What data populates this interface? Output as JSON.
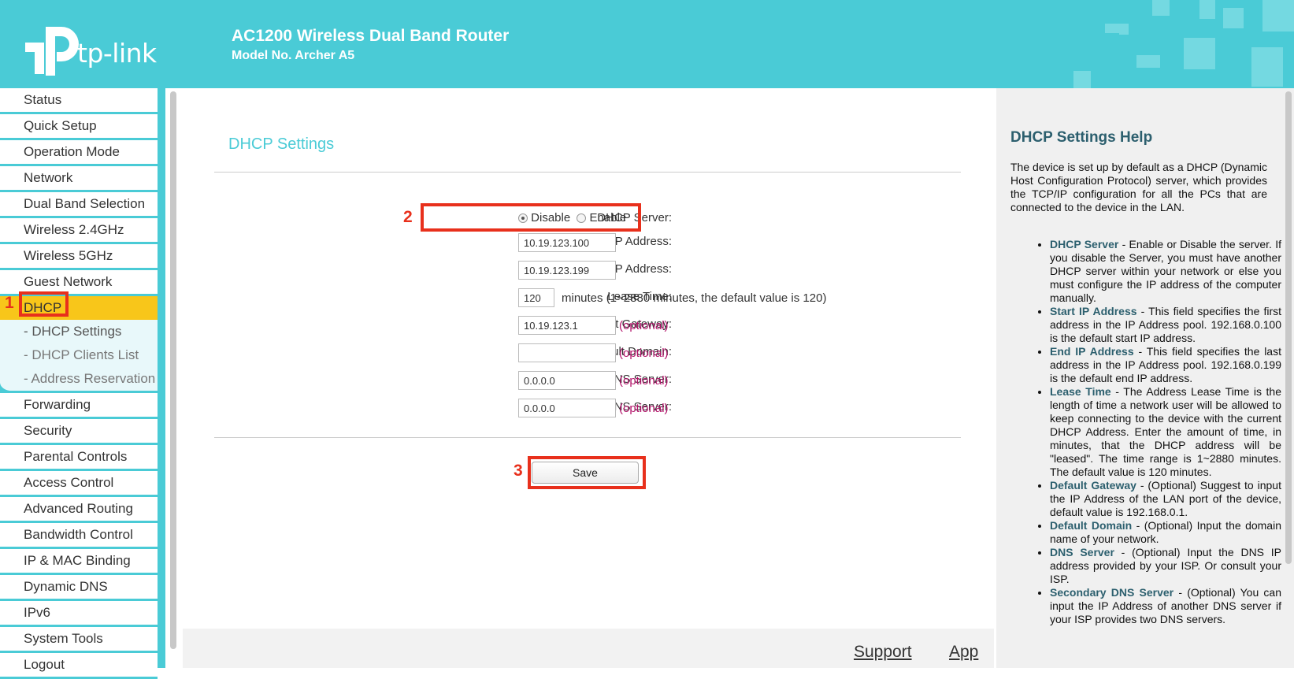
{
  "header": {
    "brand": "tp-link",
    "title": "AC1200 Wireless Dual Band Router",
    "model": "Model No. Archer A5"
  },
  "sidebar": {
    "items": [
      {
        "label": "Status"
      },
      {
        "label": "Quick Setup"
      },
      {
        "label": "Operation Mode"
      },
      {
        "label": "Network"
      },
      {
        "label": "Dual Band Selection"
      },
      {
        "label": "Wireless 2.4GHz"
      },
      {
        "label": "Wireless 5GHz"
      },
      {
        "label": "Guest Network"
      },
      {
        "label": "DHCP"
      },
      {
        "label": "Forwarding"
      },
      {
        "label": "Security"
      },
      {
        "label": "Parental Controls"
      },
      {
        "label": "Access Control"
      },
      {
        "label": "Advanced Routing"
      },
      {
        "label": "Bandwidth Control"
      },
      {
        "label": "IP & MAC Binding"
      },
      {
        "label": "Dynamic DNS"
      },
      {
        "label": "IPv6"
      },
      {
        "label": "System Tools"
      },
      {
        "label": "Logout"
      }
    ],
    "dhcp_sub": [
      "- DHCP Settings",
      "- DHCP Clients List",
      "- Address Reservation"
    ]
  },
  "main": {
    "title": "DHCP Settings",
    "dhcp_server_label": "DHCP Server:",
    "disable_label": "Disable",
    "enable_label": "Enable",
    "dhcp_server_value": "Disable",
    "start_ip_label": "Start IP Address:",
    "start_ip": "10.19.123.100",
    "end_ip_label": "End IP Address:",
    "end_ip": "10.19.123.199",
    "lease_label": "Lease Time:",
    "lease": "120",
    "lease_hint": "minutes (1~2880 minutes, the default value is 120)",
    "gateway_label": "Default Gateway:",
    "gateway": "10.19.123.1",
    "domain_label": "Default Domain:",
    "domain": "",
    "dns_label": "DNS Server:",
    "dns": "0.0.0.0",
    "dns2_label": "Secondary DNS Server:",
    "dns2": "0.0.0.0",
    "optional": "(optional)",
    "save_label": "Save"
  },
  "annotations": [
    "1",
    "2",
    "3"
  ],
  "footer": {
    "support": "Support",
    "app": "App"
  },
  "help": {
    "title": "DHCP Settings Help",
    "intro": "The device is set up by default as a DHCP (Dynamic Host Configuration Protocol) server, which provides the TCP/IP configuration for all the PCs that are connected to the device in the LAN.",
    "items": [
      {
        "term": "DHCP Server",
        "text": " - Enable or Disable the server. If you disable the Server, you must have another DHCP server within your network or else you must configure the IP address of the computer manually."
      },
      {
        "term": "Start IP Address",
        "text": " - This field specifies the first address in the IP Address pool. 192.168.0.100 is the default start IP address."
      },
      {
        "term": "End IP Address",
        "text": " - This field specifies the last address in the IP Address pool. 192.168.0.199 is the default end IP address."
      },
      {
        "term": "Lease Time",
        "text": " - The Address Lease Time is the length of time a network user will be allowed to keep connecting to the device with the current DHCP Address. Enter the amount of time, in minutes, that the DHCP address will be \"leased\". The time range is 1~2880 minutes. The default value is 120 minutes."
      },
      {
        "term": "Default Gateway",
        "text": " - (Optional) Suggest to input the IP Address of the LAN port of the device, default value is 192.168.0.1."
      },
      {
        "term": "Default Domain",
        "text": " - (Optional) Input the domain name of your network."
      },
      {
        "term": "DNS Server",
        "text": " - (Optional) Input the DNS IP address provided by your ISP. Or consult your ISP."
      },
      {
        "term": "Secondary DNS Server",
        "text": " - (Optional) You can input the IP Address of another DNS server if your ISP provides two DNS servers."
      }
    ]
  },
  "colors": {
    "brand": "#4acbd6",
    "active": "#f8c61a",
    "annotation": "#e8301c",
    "optional": "#b3136a"
  }
}
